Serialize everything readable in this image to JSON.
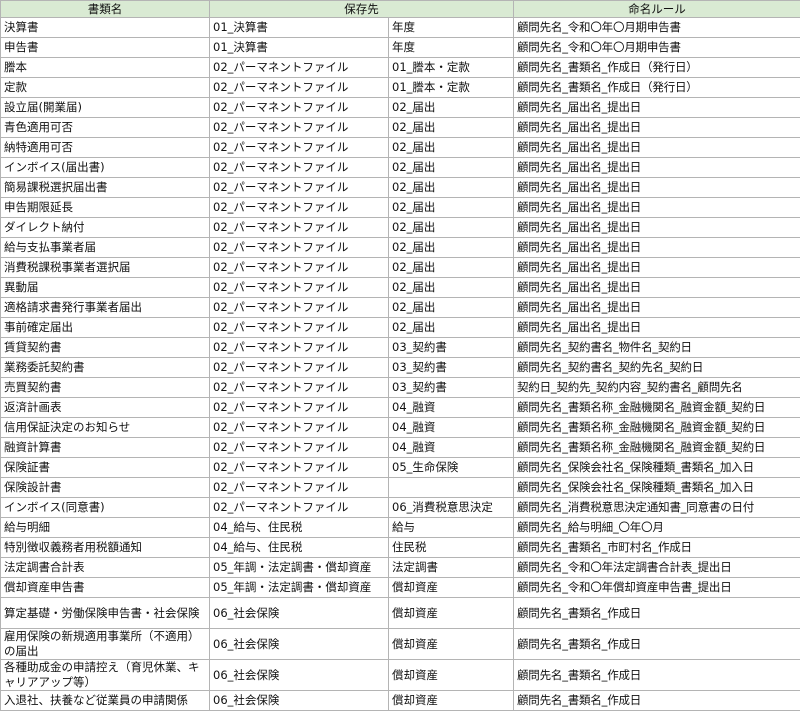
{
  "headers": {
    "document": "書類名",
    "folder": "保存先",
    "naming": "命名ルール"
  },
  "rows": [
    {
      "doc": "決算書",
      "f1": "01_決算書",
      "f2": "年度",
      "rule": "顧問先名_令和〇年〇月期申告書"
    },
    {
      "doc": "申告書",
      "f1": "01_決算書",
      "f2": "年度",
      "rule": "顧問先名_令和〇年〇月期申告書"
    },
    {
      "doc": "謄本",
      "f1": "02_パーマネントファイル",
      "f2": "01_謄本・定款",
      "rule": "顧問先名_書類名_作成日（発行日）"
    },
    {
      "doc": "定款",
      "f1": "02_パーマネントファイル",
      "f2": "01_謄本・定款",
      "rule": "顧問先名_書類名_作成日（発行日）"
    },
    {
      "doc": "設立届(開業届)",
      "f1": "02_パーマネントファイル",
      "f2": "02_届出",
      "rule": "顧問先名_届出名_提出日"
    },
    {
      "doc": "青色適用可否",
      "f1": "02_パーマネントファイル",
      "f2": "02_届出",
      "rule": "顧問先名_届出名_提出日"
    },
    {
      "doc": "納特適用可否",
      "f1": "02_パーマネントファイル",
      "f2": "02_届出",
      "rule": "顧問先名_届出名_提出日"
    },
    {
      "doc": "インボイス(届出書)",
      "f1": "02_パーマネントファイル",
      "f2": "02_届出",
      "rule": "顧問先名_届出名_提出日"
    },
    {
      "doc": "簡易課税選択届出書",
      "f1": "02_パーマネントファイル",
      "f2": "02_届出",
      "rule": "顧問先名_届出名_提出日"
    },
    {
      "doc": "申告期限延長",
      "f1": "02_パーマネントファイル",
      "f2": "02_届出",
      "rule": "顧問先名_届出名_提出日"
    },
    {
      "doc": "ダイレクト納付",
      "f1": "02_パーマネントファイル",
      "f2": "02_届出",
      "rule": "顧問先名_届出名_提出日"
    },
    {
      "doc": "給与支払事業者届",
      "f1": "02_パーマネントファイル",
      "f2": "02_届出",
      "rule": "顧問先名_届出名_提出日"
    },
    {
      "doc": "消費税課税事業者選択届",
      "f1": "02_パーマネントファイル",
      "f2": "02_届出",
      "rule": "顧問先名_届出名_提出日"
    },
    {
      "doc": "異動届",
      "f1": "02_パーマネントファイル",
      "f2": "02_届出",
      "rule": "顧問先名_届出名_提出日"
    },
    {
      "doc": "適格請求書発行事業者届出",
      "f1": "02_パーマネントファイル",
      "f2": "02_届出",
      "rule": "顧問先名_届出名_提出日"
    },
    {
      "doc": "事前確定届出",
      "f1": "02_パーマネントファイル",
      "f2": "02_届出",
      "rule": "顧問先名_届出名_提出日"
    },
    {
      "doc": "賃貸契約書",
      "f1": "02_パーマネントファイル",
      "f2": "03_契約書",
      "rule": "顧問先名_契約書名_物件名_契約日"
    },
    {
      "doc": "業務委託契約書",
      "f1": "02_パーマネントファイル",
      "f2": "03_契約書",
      "rule": "顧問先名_契約書名_契約先名_契約日"
    },
    {
      "doc": "売買契約書",
      "f1": "02_パーマネントファイル",
      "f2": "03_契約書",
      "rule": "契約日_契約先_契約内容_契約書名_顧問先名"
    },
    {
      "doc": "返済計画表",
      "f1": "02_パーマネントファイル",
      "f2": "04_融資",
      "rule": "顧問先名_書類名称_金融機関名_融資金額_契約日"
    },
    {
      "doc": "信用保証決定のお知らせ",
      "f1": "02_パーマネントファイル",
      "f2": "04_融資",
      "rule": "顧問先名_書類名称_金融機関名_融資金額_契約日"
    },
    {
      "doc": "融資計算書",
      "f1": "02_パーマネントファイル",
      "f2": "04_融資",
      "rule": "顧問先名_書類名称_金融機関名_融資金額_契約日"
    },
    {
      "doc": "保険証書",
      "f1": "02_パーマネントファイル",
      "f2": "05_生命保険",
      "rule": "顧問先名_保険会社名_保険種類_書類名_加入日"
    },
    {
      "doc": "保険設計書",
      "f1": "02_パーマネントファイル",
      "f2": "",
      "rule": "顧問先名_保険会社名_保険種類_書類名_加入日"
    },
    {
      "doc": "インボイス(同意書)",
      "f1": "02_パーマネントファイル",
      "f2": "06_消費税意思決定",
      "rule": "顧問先名_消費税意思決定通知書_同意書の日付"
    },
    {
      "doc": "給与明細",
      "f1": "04_給与、住民税",
      "f2": "給与",
      "rule": "顧問先名_給与明細_〇年〇月"
    },
    {
      "doc": "特別徴収義務者用税額通知",
      "f1": "04_給与、住民税",
      "f2": "住民税",
      "rule": "顧問先名_書類名_市町村名_作成日"
    },
    {
      "doc": "法定調書合計表",
      "f1": "05_年調・法定調書・償却資産",
      "f2": "法定調書",
      "rule": "顧問先名_令和〇年法定調書合計表_提出日"
    },
    {
      "doc": "償却資産申告書",
      "f1": "05_年調・法定調書・償却資産",
      "f2": "償却資産",
      "rule": "顧問先名_令和〇年償却資産申告書_提出日"
    },
    {
      "doc": "算定基礎・労働保険申告書・社会保険",
      "f1": "06_社会保険",
      "f2": "償却資産",
      "rule": "顧問先名_書類名_作成日"
    },
    {
      "doc": "雇用保険の新規適用事業所（不適用）の届出",
      "f1": "06_社会保険",
      "f2": "償却資産",
      "rule": "顧問先名_書類名_作成日"
    },
    {
      "doc": "各種助成金の申請控え（育児休業、キャリアアップ等）",
      "f1": "06_社会保険",
      "f2": "償却資産",
      "rule": "顧問先名_書類名_作成日"
    },
    {
      "doc": "入退社、扶養など従業員の申請関係",
      "f1": "06_社会保険",
      "f2": "償却資産",
      "rule": "顧問先名_書類名_作成日"
    }
  ]
}
